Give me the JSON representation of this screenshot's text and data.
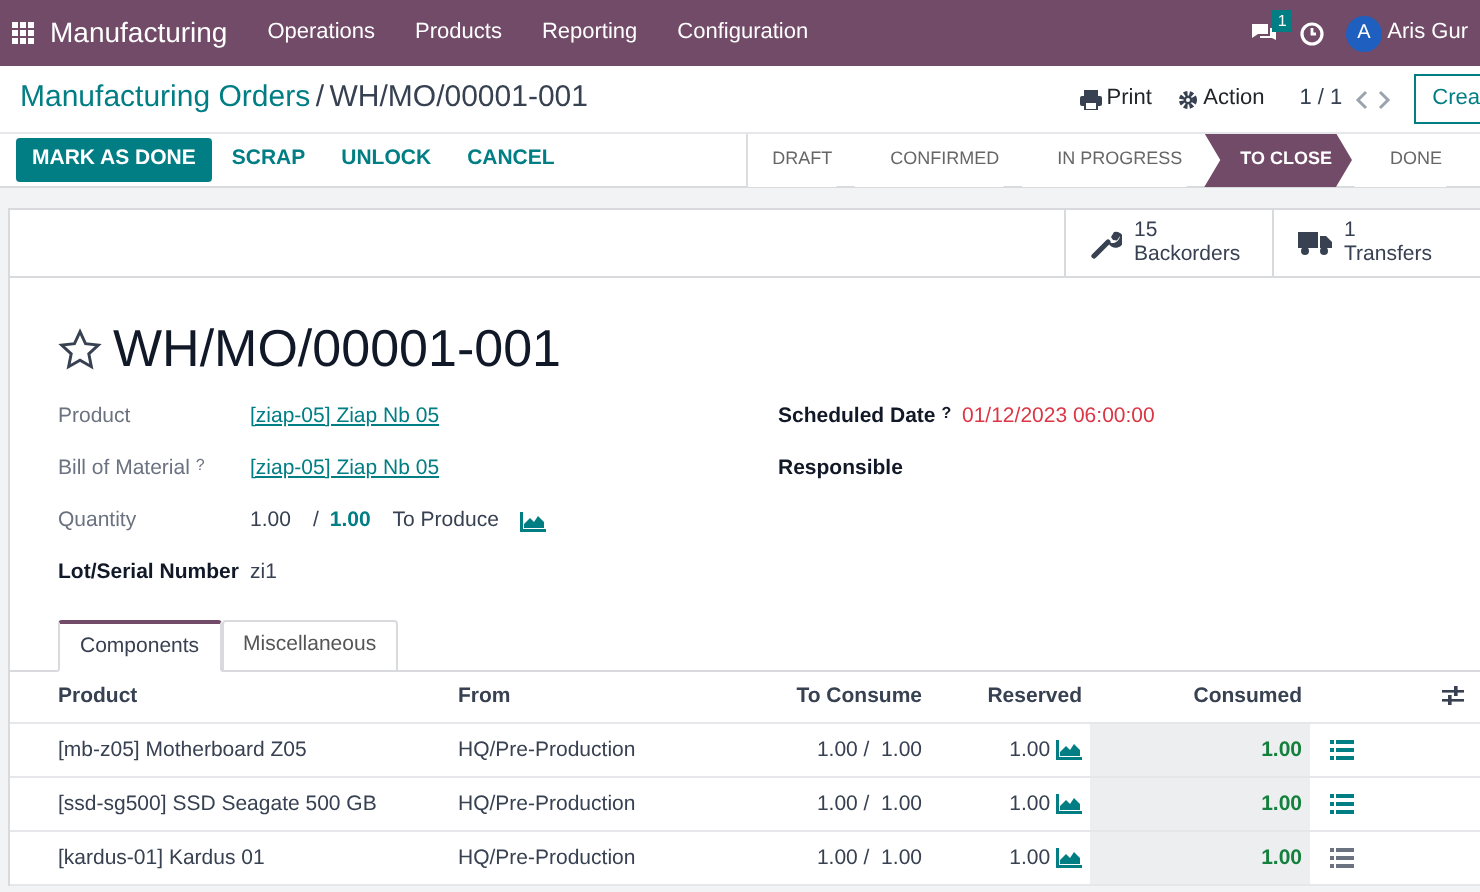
{
  "navbar": {
    "app": "Manufacturing",
    "menus": [
      "Operations",
      "Products",
      "Reporting",
      "Configuration"
    ],
    "message_count": "1",
    "user_initial": "A",
    "user_name": "Aris Gur"
  },
  "control_panel": {
    "breadcrumb": "Manufacturing Orders",
    "separator": "/",
    "record": "WH/MO/00001-001",
    "print": "Print",
    "action": "Action",
    "pager": "1 / 1",
    "create": "Crea"
  },
  "actions": [
    {
      "label": "MARK AS DONE",
      "kind": "primary"
    },
    {
      "label": "SCRAP",
      "kind": "link"
    },
    {
      "label": "UNLOCK",
      "kind": "link"
    },
    {
      "label": "CANCEL",
      "kind": "link"
    }
  ],
  "status_steps": [
    {
      "label": "DRAFT",
      "selected": false
    },
    {
      "label": "CONFIRMED",
      "selected": false
    },
    {
      "label": "IN PROGRESS",
      "selected": false
    },
    {
      "label": "TO CLOSE",
      "selected": true
    },
    {
      "label": "DONE",
      "selected": false
    }
  ],
  "smart_buttons": [
    {
      "count": "15",
      "label": "Backorders",
      "kind": "wrench"
    },
    {
      "count": "1",
      "label": "Transfers",
      "kind": "truck"
    }
  ],
  "title": "WH/MO/00001-001",
  "starred": false,
  "fields_left": [
    {
      "label": "Product",
      "value": "[ziap-05] Ziap Nb 05",
      "kind": "link"
    },
    {
      "label": "Bill of Material",
      "help": "?",
      "value": "[ziap-05] Ziap Nb 05",
      "kind": "link"
    },
    {
      "label": "Quantity",
      "kind": "quantity",
      "value": "1.00",
      "slash": "/",
      "target": "1.00",
      "unit": "To Produce"
    },
    {
      "label": "Lot/Serial Number",
      "value": "zi1",
      "kind": "text",
      "bold_label": true
    }
  ],
  "fields_right": [
    {
      "label": "Scheduled Date",
      "help": "?",
      "value": "01/12/2023 06:00:00"
    },
    {
      "label": "Responsible"
    }
  ],
  "tabs": [
    {
      "label": "Components",
      "selected": true
    },
    {
      "label": "Miscellaneous",
      "selected": false
    }
  ],
  "table": {
    "columns": [
      "Product",
      "From",
      "To Consume",
      "Reserved",
      "Consumed"
    ],
    "rows": [
      {
        "product": "[mb-z05] Motherboard Z05",
        "from": "HQ/Pre-Production",
        "to_consume": "1.00 /  1.00",
        "reserved": "1.00",
        "consumed": "1.00",
        "details_active": true
      },
      {
        "product": "[ssd-sg500] SSD Seagate 500 GB",
        "from": "HQ/Pre-Production",
        "to_consume": "1.00 /  1.00",
        "reserved": "1.00",
        "consumed": "1.00",
        "details_active": true
      },
      {
        "product": "[kardus-01] Kardus 01",
        "from": "HQ/Pre-Production",
        "to_consume": "1.00 /  1.00",
        "reserved": "1.00",
        "consumed": "1.00",
        "details_active": false
      }
    ]
  }
}
